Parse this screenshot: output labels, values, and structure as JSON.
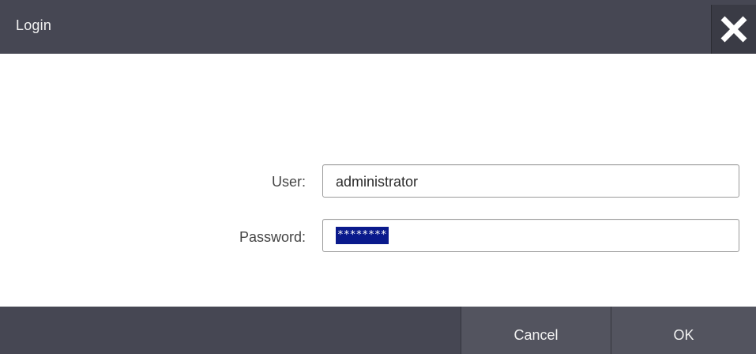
{
  "window": {
    "title": "Login",
    "close_icon": "close-icon"
  },
  "form": {
    "user_label": "User:",
    "user_value": "administrator",
    "password_label": "Password:",
    "password_value": "********"
  },
  "footer": {
    "cancel_label": "Cancel",
    "ok_label": "OK"
  },
  "colors": {
    "title_bar": "#464753",
    "footer_bar": "#464753",
    "button": "#53545f",
    "selection": "#0a1a8c",
    "background": "#ffffff"
  }
}
